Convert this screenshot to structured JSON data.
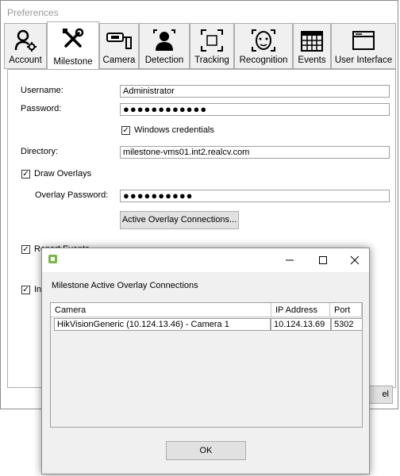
{
  "window": {
    "title": "Preferences",
    "tabs": [
      {
        "label": "Account",
        "icon": "account-gear-icon"
      },
      {
        "label": "Milestone",
        "icon": "wrench-screwdriver-icon"
      },
      {
        "label": "Camera",
        "icon": "security-camera-icon"
      },
      {
        "label": "Detection",
        "icon": "person-detection-icon"
      },
      {
        "label": "Tracking",
        "icon": "tracking-frame-icon"
      },
      {
        "label": "Recognition",
        "icon": "face-recognition-icon"
      },
      {
        "label": "Events",
        "icon": "calendar-icon"
      },
      {
        "label": "User Interface",
        "icon": "window-icon"
      }
    ],
    "active_tab": "Milestone"
  },
  "form": {
    "username_label": "Username:",
    "username_value": "Administrator",
    "password_label": "Password:",
    "password_value": "●●●●●●●●●●●●",
    "windows_credentials_label": "Windows credentials",
    "windows_credentials_checked": true,
    "directory_label": "Directory:",
    "directory_value": "milestone-vms01.int2.realcv.com",
    "draw_overlays_label": "Draw Overlays",
    "draw_overlays_checked": true,
    "overlay_password_label": "Overlay Password:",
    "overlay_password_value": "●●●●●●●●●●",
    "active_overlay_button": "Active Overlay Connections...",
    "report_events_label": "Report Events",
    "report_events_checked": true,
    "partial_label": "In",
    "partial_checked": true,
    "cancel_partial": "el"
  },
  "dialog": {
    "heading": "Milestone Active Overlay Connections",
    "columns": [
      "Camera",
      "IP Address",
      "Port"
    ],
    "rows": [
      {
        "camera": "HikVisionGeneric (10.124.13.46) - Camera 1",
        "ip": "10.124.13.69",
        "port": "5302"
      }
    ],
    "ok_label": "OK",
    "app_icon_color": "#7ab648"
  }
}
